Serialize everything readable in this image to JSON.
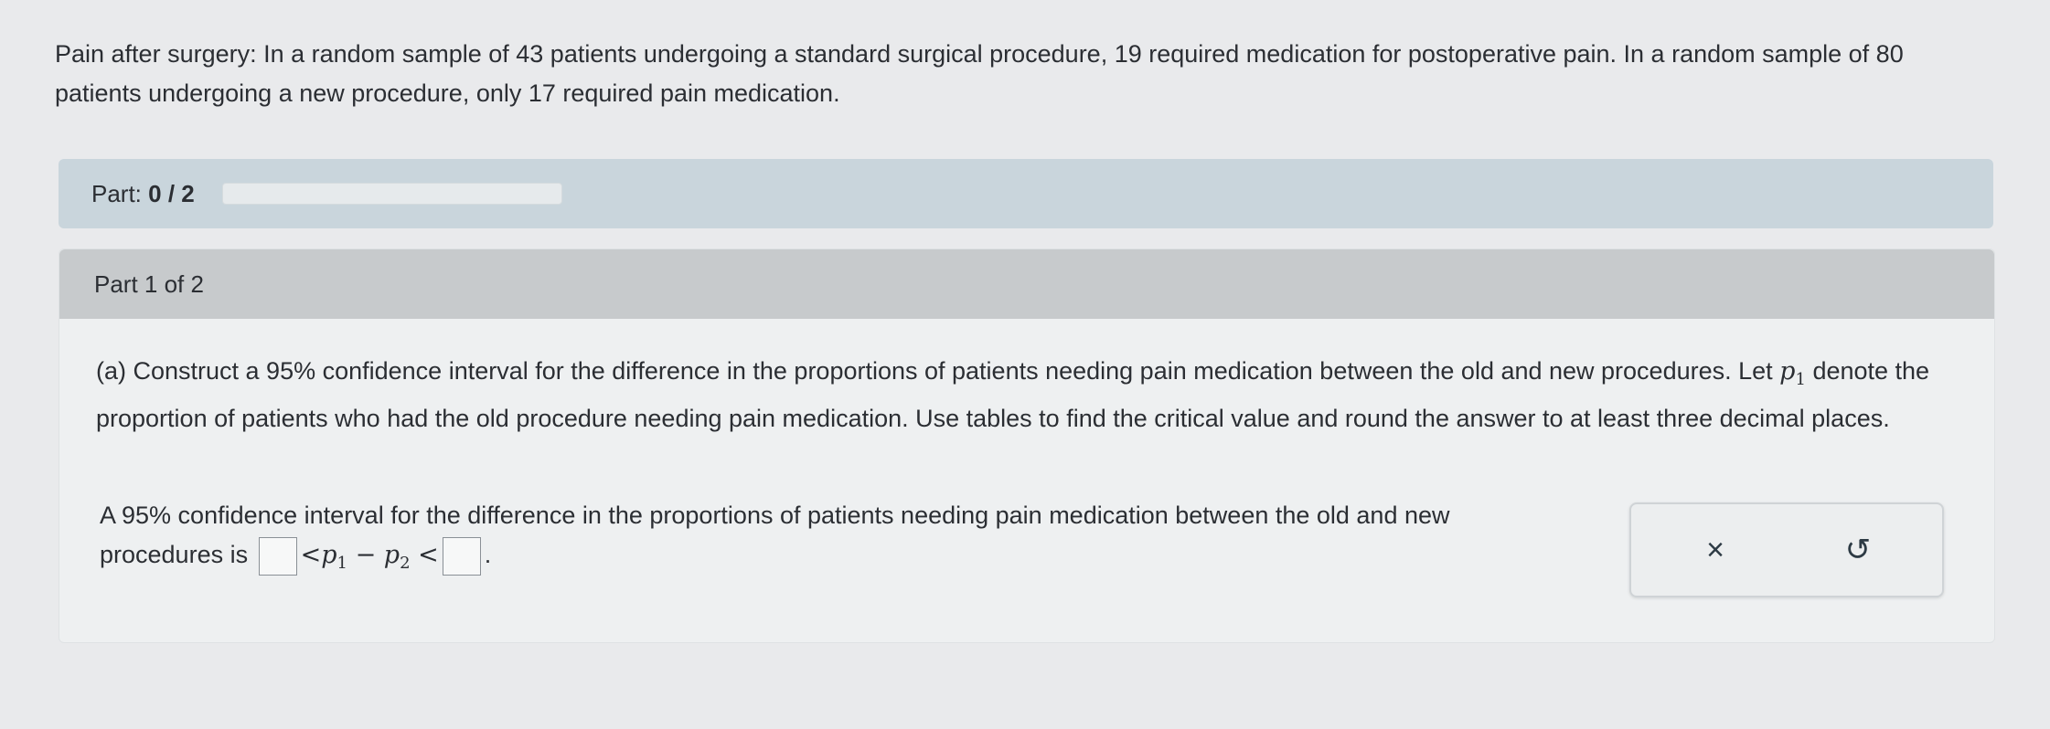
{
  "problem": {
    "lead": "Pain after surgery:",
    "text": "In a random sample of 43 patients undergoing a standard surgical procedure, 19 required medication for postoperative pain. In a random sample of 80 patients undergoing a new procedure, only 17 required pain medication."
  },
  "progress": {
    "label": "Part:",
    "value": "0 / 2",
    "fraction": 0
  },
  "part_header": "Part 1 of 2",
  "question": {
    "prefix": "(a) Construct a 95% confidence interval for the difference in the proportions of patients needing pain medication between the old and new procedures. Let",
    "var": "p",
    "var_sub": "1",
    "suffix": "denote the proportion of patients who had the old procedure needing pain medication. Use tables to find the critical value and round the answer to at least three decimal places."
  },
  "answer": {
    "line1": "A 95% confidence interval for the difference in the proportions of patients needing pain medication between the old and new",
    "line2_prefix": "procedures is",
    "lt": "<",
    "minus": "−",
    "p": "p",
    "sub1": "1",
    "sub2": "2",
    "lower_value": "",
    "upper_value": "",
    "end": "."
  },
  "tools": {
    "clear_icon": "close-icon",
    "clear_glyph": "×",
    "undo_icon": "undo-icon",
    "undo_glyph": "↺"
  }
}
